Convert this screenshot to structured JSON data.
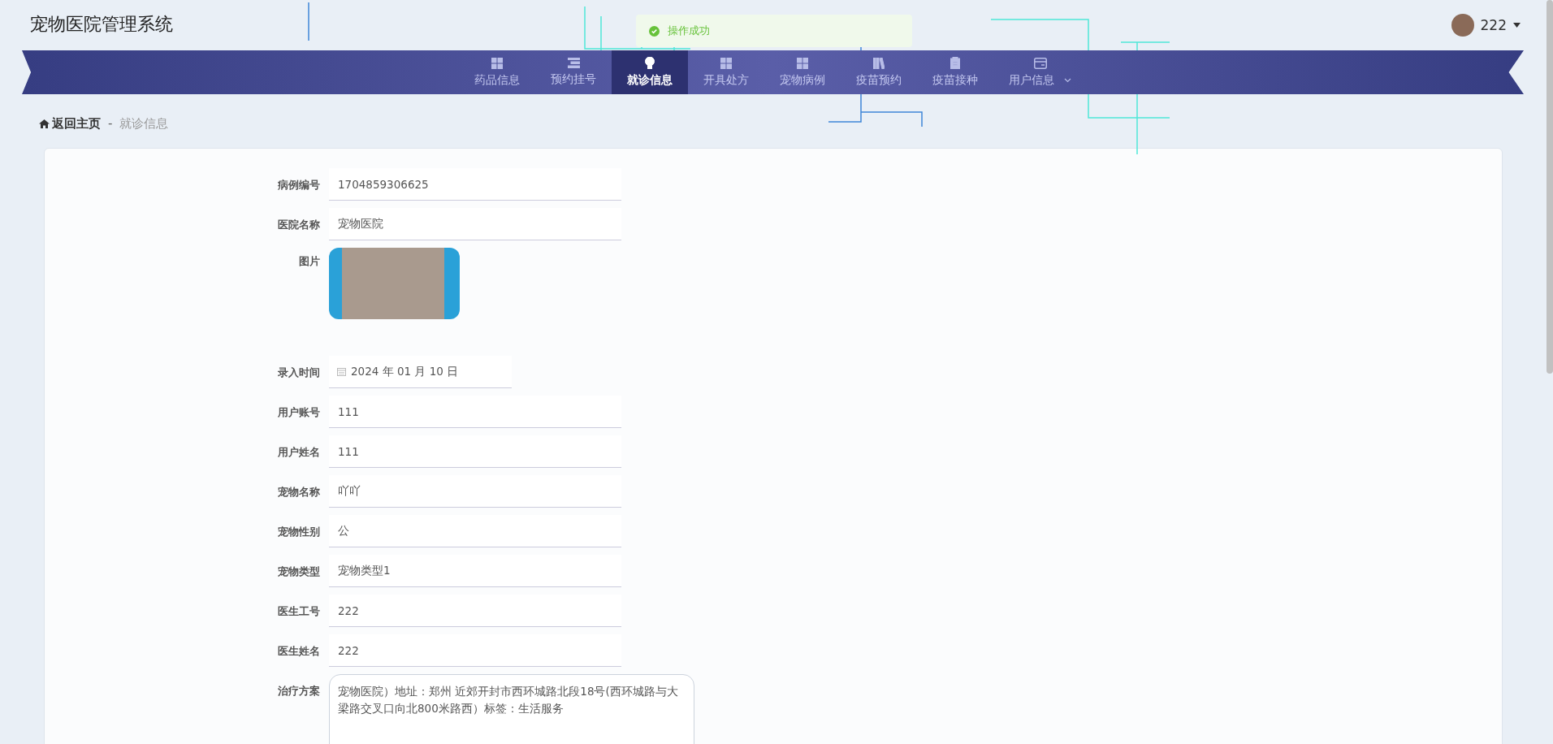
{
  "header": {
    "title": "宠物医院管理系统",
    "user": "222"
  },
  "toast": {
    "message": "操作成功"
  },
  "nav": [
    {
      "label": "药品信息",
      "kind": "grid",
      "selected": false
    },
    {
      "label": "预约挂号",
      "kind": "list",
      "selected": false
    },
    {
      "label": "就诊信息",
      "kind": "bulb",
      "selected": true
    },
    {
      "label": "开具处方",
      "kind": "grid",
      "selected": false
    },
    {
      "label": "宠物病例",
      "kind": "grid",
      "selected": false
    },
    {
      "label": "疫苗预约",
      "kind": "books",
      "selected": false
    },
    {
      "label": "疫苗接种",
      "kind": "clipboard",
      "selected": false
    },
    {
      "label": "用户信息",
      "kind": "card",
      "selected": false,
      "dropdown": true
    }
  ],
  "breadcrumb": {
    "home": "返回主页",
    "separator": "-",
    "current": "就诊信息"
  },
  "form": [
    {
      "kind": "text",
      "label": "病例编号",
      "value": "1704859306625"
    },
    {
      "kind": "text",
      "label": "医院名称",
      "value": "宠物医院"
    },
    {
      "kind": "image",
      "label": "图片"
    },
    {
      "kind": "date",
      "label": "录入时间",
      "value": "2024 年 01 月 10 日"
    },
    {
      "kind": "text",
      "label": "用户账号",
      "value": "111"
    },
    {
      "kind": "text",
      "label": "用户姓名",
      "value": "111"
    },
    {
      "kind": "text",
      "label": "宠物名称",
      "value": "吖吖"
    },
    {
      "kind": "text",
      "label": "宠物性别",
      "value": "公"
    },
    {
      "kind": "text",
      "label": "宠物类型",
      "value": "宠物类型1"
    },
    {
      "kind": "text",
      "label": "医生工号",
      "value": "222"
    },
    {
      "kind": "text",
      "label": "医生姓名",
      "value": "222"
    },
    {
      "kind": "textarea",
      "label": "治疗方案",
      "value": "宠物医院）地址：郑州 近郊开封市西环城路北段18号(西环城路与大梁路交叉口向北800米路西）标签：生活服务"
    }
  ]
}
